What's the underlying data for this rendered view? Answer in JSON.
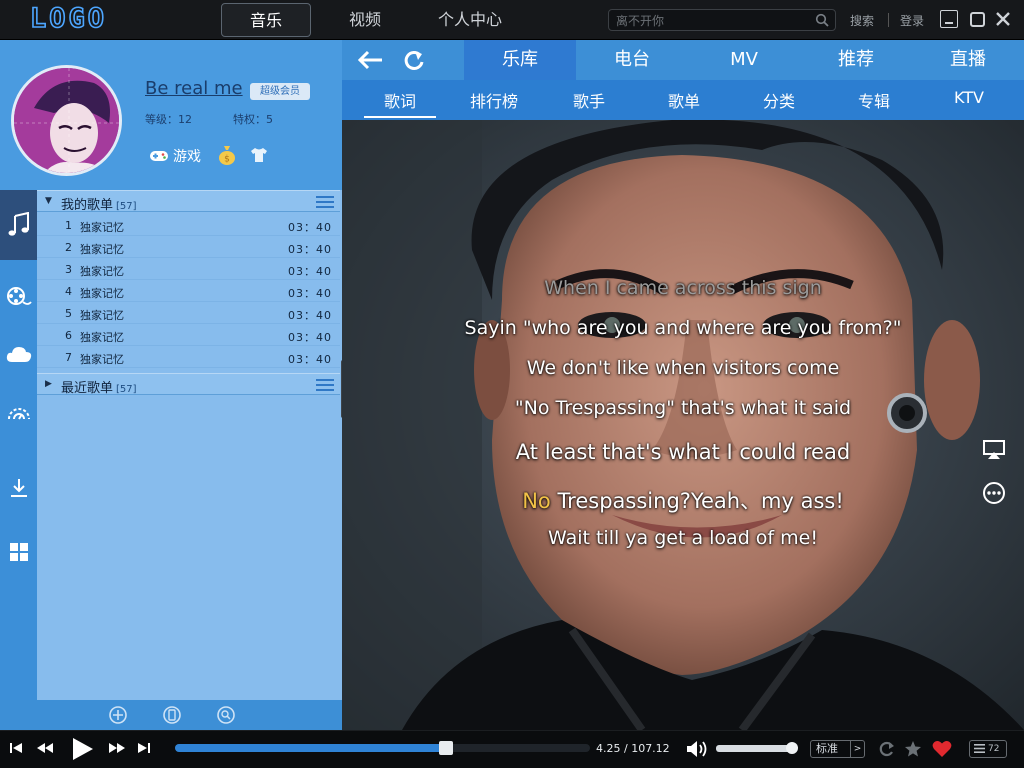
{
  "app": {
    "logo": "LOGO",
    "nav": [
      "音乐",
      "视频",
      "个人中心"
    ],
    "search_placeholder": "离不开你",
    "search_link": "搜索",
    "login_link": "登录"
  },
  "profile": {
    "username": "Be real me",
    "vip_badge": "超级会员",
    "level": "等级：12",
    "privilege": "特权：5",
    "game_link": "游戏"
  },
  "sidebar_icons": [
    "music-note-icon",
    "video-reel-icon",
    "cloud-icon",
    "radio-icon",
    "download-icon",
    "apps-grid-icon"
  ],
  "playlists": {
    "mine": {
      "title": "我的歌单",
      "count": "[57]"
    },
    "recent": {
      "title": "最近歌单",
      "count": "[57]"
    },
    "songs": [
      {
        "num": "1",
        "title": "独家记忆",
        "duration": "03：40"
      },
      {
        "num": "2",
        "title": "独家记忆",
        "duration": "03：40"
      },
      {
        "num": "3",
        "title": "独家记忆",
        "duration": "03：40"
      },
      {
        "num": "4",
        "title": "独家记忆",
        "duration": "03：40"
      },
      {
        "num": "5",
        "title": "独家记忆",
        "duration": "03：40"
      },
      {
        "num": "6",
        "title": "独家记忆",
        "duration": "03：40"
      },
      {
        "num": "7",
        "title": "独家记忆",
        "duration": "03：40"
      }
    ]
  },
  "main_tabs": [
    "乐库",
    "电台",
    "MV",
    "推荐",
    "直播"
  ],
  "sub_tabs": [
    "歌词",
    "排行榜",
    "歌手",
    "歌单",
    "分类",
    "专辑",
    "KTV"
  ],
  "lyrics": {
    "line0": "When I came across this sign",
    "line1": "Sayin \"who are you and where are you from?\"",
    "line2": "We don't like when visitors come",
    "line3": "\"No Trespassing\" that's what it said",
    "line4": "At least that's what I could read",
    "line5_highlight": "No",
    "line5_rest": " Trespassing?Yeah、my ass!",
    "line6": "Wait till ya get a load of me!"
  },
  "player": {
    "time": "4.25 / 107.12",
    "progress": 0.653,
    "volume": 0.93,
    "quality": "标准",
    "list_count": "72",
    "accent": "#2f83d6",
    "love_color": "#e0292f"
  }
}
